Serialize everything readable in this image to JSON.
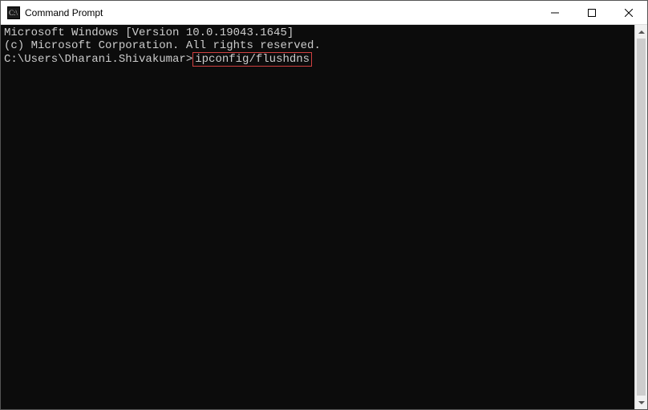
{
  "window": {
    "title": "Command Prompt"
  },
  "terminal": {
    "line1": "Microsoft Windows [Version 10.0.19043.1645]",
    "line2": "(c) Microsoft Corporation. All rights reserved.",
    "blank": "",
    "prompt": "C:\\Users\\Dharani.Shivakumar>",
    "command": "ipconfig/flushdns"
  },
  "icons": {
    "cmd": "cmd-icon",
    "minimize": "minimize-icon",
    "maximize": "maximize-icon",
    "close": "close-icon",
    "scroll_up": "scroll-up-icon",
    "scroll_down": "scroll-down-icon"
  }
}
